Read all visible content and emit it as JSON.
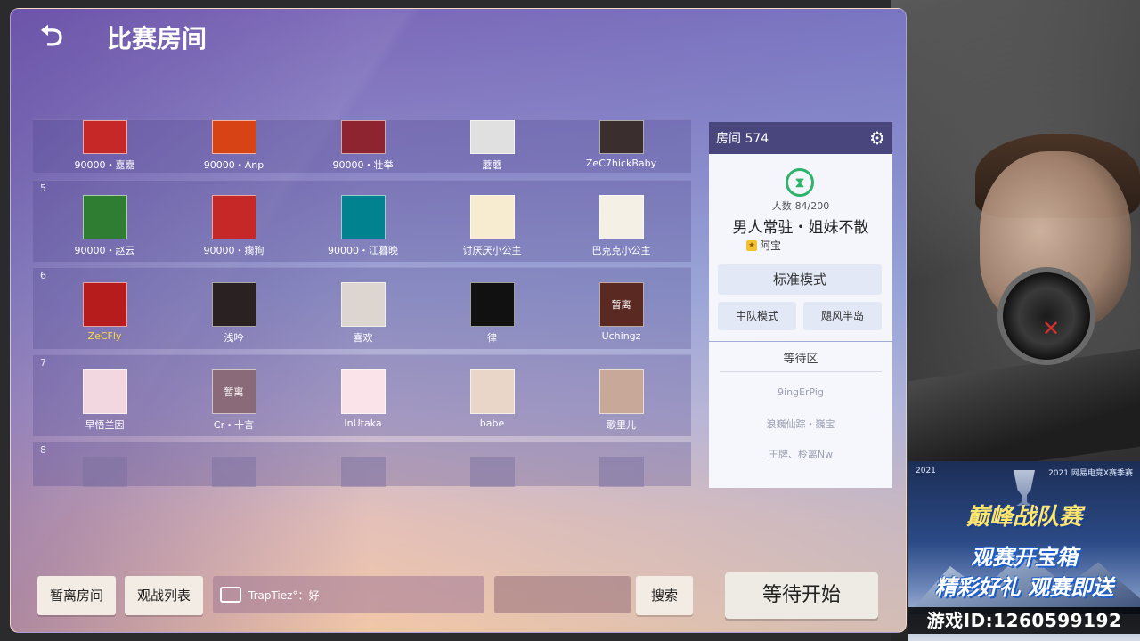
{
  "header": {
    "title": "比赛房间",
    "back_icon": "back-arrow-icon"
  },
  "teams": [
    {
      "row": "",
      "players": [
        {
          "name": "90000・嘉嘉",
          "avatar": "#c62828"
        },
        {
          "name": "90000・Anp",
          "avatar": "#d84315"
        },
        {
          "name": "90000・壮举",
          "avatar": "#8e2430"
        },
        {
          "name": "蘑蘑",
          "avatar": "#e0e0e0"
        },
        {
          "name": "ZeC7hickBaby",
          "avatar": "#3a2e2e"
        }
      ]
    },
    {
      "row": "5",
      "players": [
        {
          "name": "90000・赵云",
          "avatar": "#2e7d32"
        },
        {
          "name": "90000・瘸狗",
          "avatar": "#c62828"
        },
        {
          "name": "90000・江暮晚",
          "avatar": "#00838f"
        },
        {
          "name": "讨厌厌小公主",
          "avatar": "#f7ecd0"
        },
        {
          "name": "巴克克小公主",
          "avatar": "#f5f0e6"
        }
      ]
    },
    {
      "row": "6",
      "players": [
        {
          "name": "ZeCFly",
          "avatar": "#b71c1c",
          "gold": true
        },
        {
          "name": "浅吟",
          "avatar": "#2a2222"
        },
        {
          "name": "喜欢",
          "avatar": "#ddd6d0"
        },
        {
          "name": "律",
          "avatar": "#111111"
        },
        {
          "name": "Uchingz",
          "avatar": "#5a2a22",
          "tag": "暂离"
        }
      ]
    },
    {
      "row": "7",
      "players": [
        {
          "name": "早悟兰因",
          "avatar": "#f2d6e0"
        },
        {
          "name": "Cr・十言",
          "avatar": "#8a6a78",
          "tag": "暂离"
        },
        {
          "name": "InUtaka",
          "avatar": "#fbe3ea"
        },
        {
          "name": "babe",
          "avatar": "#ead6c8"
        },
        {
          "name": "歌里儿",
          "avatar": "#c8a898"
        }
      ]
    },
    {
      "row": "8",
      "players": []
    }
  ],
  "room": {
    "title": "房间 574",
    "count_label": "人数",
    "count": "84/200",
    "name": "男人常驻・姐妹不散",
    "host": "阿宝",
    "mode": "标准模式",
    "sub_mode_a": "中队模式",
    "sub_mode_b": "飓风半岛"
  },
  "waiting": {
    "title": "等待区",
    "items": [
      "9ingErPig",
      "浪巍仙踪・巍宝",
      "王牌、柃离Nw"
    ]
  },
  "bottom": {
    "leave_label": "暂离房间",
    "spectate_label": "观战列表",
    "chat_text": "TrapTiez°：好",
    "search_label": "搜索",
    "start_label": "等待开始"
  },
  "ad": {
    "top_left": "2021",
    "top_right": "2021 网易电竞X赛季赛",
    "title": "巅峰战队赛",
    "line1": "观赛开宝箱",
    "line2": "精彩好礼 观赛即送",
    "game_id": "游戏ID:1260599192"
  }
}
